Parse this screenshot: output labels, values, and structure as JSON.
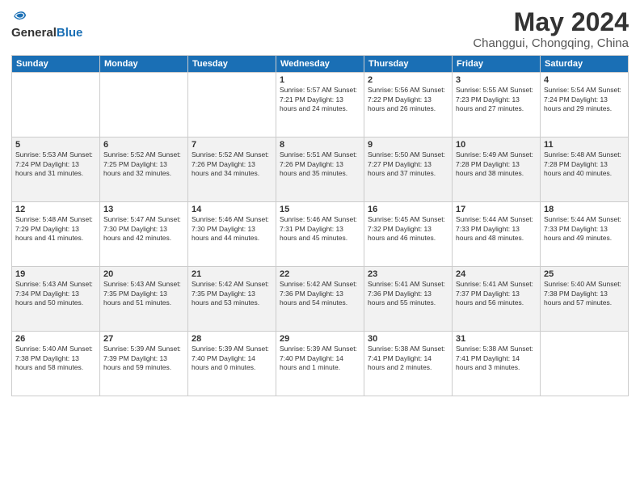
{
  "header": {
    "logo_general": "General",
    "logo_blue": "Blue",
    "month": "May 2024",
    "location": "Changgui, Chongqing, China"
  },
  "weekdays": [
    "Sunday",
    "Monday",
    "Tuesday",
    "Wednesday",
    "Thursday",
    "Friday",
    "Saturday"
  ],
  "weeks": [
    [
      {
        "day": "",
        "info": ""
      },
      {
        "day": "",
        "info": ""
      },
      {
        "day": "",
        "info": ""
      },
      {
        "day": "1",
        "info": "Sunrise: 5:57 AM\nSunset: 7:21 PM\nDaylight: 13 hours\nand 24 minutes."
      },
      {
        "day": "2",
        "info": "Sunrise: 5:56 AM\nSunset: 7:22 PM\nDaylight: 13 hours\nand 26 minutes."
      },
      {
        "day": "3",
        "info": "Sunrise: 5:55 AM\nSunset: 7:23 PM\nDaylight: 13 hours\nand 27 minutes."
      },
      {
        "day": "4",
        "info": "Sunrise: 5:54 AM\nSunset: 7:24 PM\nDaylight: 13 hours\nand 29 minutes."
      }
    ],
    [
      {
        "day": "5",
        "info": "Sunrise: 5:53 AM\nSunset: 7:24 PM\nDaylight: 13 hours\nand 31 minutes."
      },
      {
        "day": "6",
        "info": "Sunrise: 5:52 AM\nSunset: 7:25 PM\nDaylight: 13 hours\nand 32 minutes."
      },
      {
        "day": "7",
        "info": "Sunrise: 5:52 AM\nSunset: 7:26 PM\nDaylight: 13 hours\nand 34 minutes."
      },
      {
        "day": "8",
        "info": "Sunrise: 5:51 AM\nSunset: 7:26 PM\nDaylight: 13 hours\nand 35 minutes."
      },
      {
        "day": "9",
        "info": "Sunrise: 5:50 AM\nSunset: 7:27 PM\nDaylight: 13 hours\nand 37 minutes."
      },
      {
        "day": "10",
        "info": "Sunrise: 5:49 AM\nSunset: 7:28 PM\nDaylight: 13 hours\nand 38 minutes."
      },
      {
        "day": "11",
        "info": "Sunrise: 5:48 AM\nSunset: 7:28 PM\nDaylight: 13 hours\nand 40 minutes."
      }
    ],
    [
      {
        "day": "12",
        "info": "Sunrise: 5:48 AM\nSunset: 7:29 PM\nDaylight: 13 hours\nand 41 minutes."
      },
      {
        "day": "13",
        "info": "Sunrise: 5:47 AM\nSunset: 7:30 PM\nDaylight: 13 hours\nand 42 minutes."
      },
      {
        "day": "14",
        "info": "Sunrise: 5:46 AM\nSunset: 7:30 PM\nDaylight: 13 hours\nand 44 minutes."
      },
      {
        "day": "15",
        "info": "Sunrise: 5:46 AM\nSunset: 7:31 PM\nDaylight: 13 hours\nand 45 minutes."
      },
      {
        "day": "16",
        "info": "Sunrise: 5:45 AM\nSunset: 7:32 PM\nDaylight: 13 hours\nand 46 minutes."
      },
      {
        "day": "17",
        "info": "Sunrise: 5:44 AM\nSunset: 7:33 PM\nDaylight: 13 hours\nand 48 minutes."
      },
      {
        "day": "18",
        "info": "Sunrise: 5:44 AM\nSunset: 7:33 PM\nDaylight: 13 hours\nand 49 minutes."
      }
    ],
    [
      {
        "day": "19",
        "info": "Sunrise: 5:43 AM\nSunset: 7:34 PM\nDaylight: 13 hours\nand 50 minutes."
      },
      {
        "day": "20",
        "info": "Sunrise: 5:43 AM\nSunset: 7:35 PM\nDaylight: 13 hours\nand 51 minutes."
      },
      {
        "day": "21",
        "info": "Sunrise: 5:42 AM\nSunset: 7:35 PM\nDaylight: 13 hours\nand 53 minutes."
      },
      {
        "day": "22",
        "info": "Sunrise: 5:42 AM\nSunset: 7:36 PM\nDaylight: 13 hours\nand 54 minutes."
      },
      {
        "day": "23",
        "info": "Sunrise: 5:41 AM\nSunset: 7:36 PM\nDaylight: 13 hours\nand 55 minutes."
      },
      {
        "day": "24",
        "info": "Sunrise: 5:41 AM\nSunset: 7:37 PM\nDaylight: 13 hours\nand 56 minutes."
      },
      {
        "day": "25",
        "info": "Sunrise: 5:40 AM\nSunset: 7:38 PM\nDaylight: 13 hours\nand 57 minutes."
      }
    ],
    [
      {
        "day": "26",
        "info": "Sunrise: 5:40 AM\nSunset: 7:38 PM\nDaylight: 13 hours\nand 58 minutes."
      },
      {
        "day": "27",
        "info": "Sunrise: 5:39 AM\nSunset: 7:39 PM\nDaylight: 13 hours\nand 59 minutes."
      },
      {
        "day": "28",
        "info": "Sunrise: 5:39 AM\nSunset: 7:40 PM\nDaylight: 14 hours\nand 0 minutes."
      },
      {
        "day": "29",
        "info": "Sunrise: 5:39 AM\nSunset: 7:40 PM\nDaylight: 14 hours\nand 1 minute."
      },
      {
        "day": "30",
        "info": "Sunrise: 5:38 AM\nSunset: 7:41 PM\nDaylight: 14 hours\nand 2 minutes."
      },
      {
        "day": "31",
        "info": "Sunrise: 5:38 AM\nSunset: 7:41 PM\nDaylight: 14 hours\nand 3 minutes."
      },
      {
        "day": "",
        "info": ""
      }
    ]
  ]
}
